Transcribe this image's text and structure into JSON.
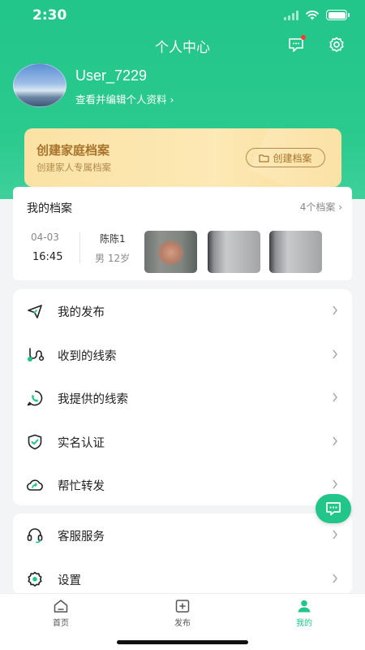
{
  "status": {
    "time": "2:30"
  },
  "header": {
    "title": "个人中心"
  },
  "user": {
    "name": "User_7229",
    "edit_link": "查看并编辑个人资料 ›"
  },
  "family_banner": {
    "title": "创建家庭档案",
    "subtitle": "创建家人专属档案",
    "button": "创建档案"
  },
  "archives": {
    "title": "我的档案",
    "count": "4个档案 ›",
    "latest": {
      "date": "04-03",
      "time": "16:45",
      "name": "陈陈1",
      "info": "男 12岁"
    }
  },
  "menu_group1": [
    {
      "label": "我的发布",
      "icon": "paper-plane-icon"
    },
    {
      "label": "收到的线索",
      "icon": "clue-path-icon"
    },
    {
      "label": "我提供的线索",
      "icon": "phone-chat-icon"
    },
    {
      "label": "实名认证",
      "icon": "shield-check-icon"
    },
    {
      "label": "帮忙转发",
      "icon": "share-cloud-icon"
    }
  ],
  "menu_group2": [
    {
      "label": "客服服务",
      "icon": "headset-icon"
    },
    {
      "label": "设置",
      "icon": "settings-icon"
    }
  ],
  "tabbar": {
    "home": "首页",
    "post": "发布",
    "me": "我的"
  },
  "colors": {
    "primary": "#22c58a",
    "banner_text": "#a8742c",
    "page_bg": "#f3f4f5"
  }
}
